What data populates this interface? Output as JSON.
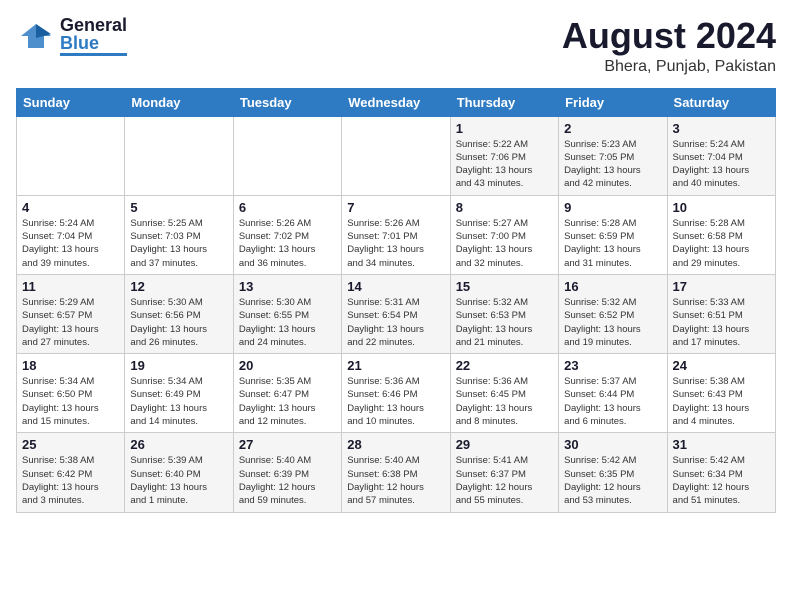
{
  "header": {
    "logo_general": "General",
    "logo_blue": "Blue",
    "main_title": "August 2024",
    "subtitle": "Bhera, Punjab, Pakistan"
  },
  "days_of_week": [
    "Sunday",
    "Monday",
    "Tuesday",
    "Wednesday",
    "Thursday",
    "Friday",
    "Saturday"
  ],
  "weeks": [
    [
      {
        "day": "",
        "details": ""
      },
      {
        "day": "",
        "details": ""
      },
      {
        "day": "",
        "details": ""
      },
      {
        "day": "",
        "details": ""
      },
      {
        "day": "1",
        "details": "Sunrise: 5:22 AM\nSunset: 7:06 PM\nDaylight: 13 hours\nand 43 minutes."
      },
      {
        "day": "2",
        "details": "Sunrise: 5:23 AM\nSunset: 7:05 PM\nDaylight: 13 hours\nand 42 minutes."
      },
      {
        "day": "3",
        "details": "Sunrise: 5:24 AM\nSunset: 7:04 PM\nDaylight: 13 hours\nand 40 minutes."
      }
    ],
    [
      {
        "day": "4",
        "details": "Sunrise: 5:24 AM\nSunset: 7:04 PM\nDaylight: 13 hours\nand 39 minutes."
      },
      {
        "day": "5",
        "details": "Sunrise: 5:25 AM\nSunset: 7:03 PM\nDaylight: 13 hours\nand 37 minutes."
      },
      {
        "day": "6",
        "details": "Sunrise: 5:26 AM\nSunset: 7:02 PM\nDaylight: 13 hours\nand 36 minutes."
      },
      {
        "day": "7",
        "details": "Sunrise: 5:26 AM\nSunset: 7:01 PM\nDaylight: 13 hours\nand 34 minutes."
      },
      {
        "day": "8",
        "details": "Sunrise: 5:27 AM\nSunset: 7:00 PM\nDaylight: 13 hours\nand 32 minutes."
      },
      {
        "day": "9",
        "details": "Sunrise: 5:28 AM\nSunset: 6:59 PM\nDaylight: 13 hours\nand 31 minutes."
      },
      {
        "day": "10",
        "details": "Sunrise: 5:28 AM\nSunset: 6:58 PM\nDaylight: 13 hours\nand 29 minutes."
      }
    ],
    [
      {
        "day": "11",
        "details": "Sunrise: 5:29 AM\nSunset: 6:57 PM\nDaylight: 13 hours\nand 27 minutes."
      },
      {
        "day": "12",
        "details": "Sunrise: 5:30 AM\nSunset: 6:56 PM\nDaylight: 13 hours\nand 26 minutes."
      },
      {
        "day": "13",
        "details": "Sunrise: 5:30 AM\nSunset: 6:55 PM\nDaylight: 13 hours\nand 24 minutes."
      },
      {
        "day": "14",
        "details": "Sunrise: 5:31 AM\nSunset: 6:54 PM\nDaylight: 13 hours\nand 22 minutes."
      },
      {
        "day": "15",
        "details": "Sunrise: 5:32 AM\nSunset: 6:53 PM\nDaylight: 13 hours\nand 21 minutes."
      },
      {
        "day": "16",
        "details": "Sunrise: 5:32 AM\nSunset: 6:52 PM\nDaylight: 13 hours\nand 19 minutes."
      },
      {
        "day": "17",
        "details": "Sunrise: 5:33 AM\nSunset: 6:51 PM\nDaylight: 13 hours\nand 17 minutes."
      }
    ],
    [
      {
        "day": "18",
        "details": "Sunrise: 5:34 AM\nSunset: 6:50 PM\nDaylight: 13 hours\nand 15 minutes."
      },
      {
        "day": "19",
        "details": "Sunrise: 5:34 AM\nSunset: 6:49 PM\nDaylight: 13 hours\nand 14 minutes."
      },
      {
        "day": "20",
        "details": "Sunrise: 5:35 AM\nSunset: 6:47 PM\nDaylight: 13 hours\nand 12 minutes."
      },
      {
        "day": "21",
        "details": "Sunrise: 5:36 AM\nSunset: 6:46 PM\nDaylight: 13 hours\nand 10 minutes."
      },
      {
        "day": "22",
        "details": "Sunrise: 5:36 AM\nSunset: 6:45 PM\nDaylight: 13 hours\nand 8 minutes."
      },
      {
        "day": "23",
        "details": "Sunrise: 5:37 AM\nSunset: 6:44 PM\nDaylight: 13 hours\nand 6 minutes."
      },
      {
        "day": "24",
        "details": "Sunrise: 5:38 AM\nSunset: 6:43 PM\nDaylight: 13 hours\nand 4 minutes."
      }
    ],
    [
      {
        "day": "25",
        "details": "Sunrise: 5:38 AM\nSunset: 6:42 PM\nDaylight: 13 hours\nand 3 minutes."
      },
      {
        "day": "26",
        "details": "Sunrise: 5:39 AM\nSunset: 6:40 PM\nDaylight: 13 hours\nand 1 minute."
      },
      {
        "day": "27",
        "details": "Sunrise: 5:40 AM\nSunset: 6:39 PM\nDaylight: 12 hours\nand 59 minutes."
      },
      {
        "day": "28",
        "details": "Sunrise: 5:40 AM\nSunset: 6:38 PM\nDaylight: 12 hours\nand 57 minutes."
      },
      {
        "day": "29",
        "details": "Sunrise: 5:41 AM\nSunset: 6:37 PM\nDaylight: 12 hours\nand 55 minutes."
      },
      {
        "day": "30",
        "details": "Sunrise: 5:42 AM\nSunset: 6:35 PM\nDaylight: 12 hours\nand 53 minutes."
      },
      {
        "day": "31",
        "details": "Sunrise: 5:42 AM\nSunset: 6:34 PM\nDaylight: 12 hours\nand 51 minutes."
      }
    ]
  ]
}
